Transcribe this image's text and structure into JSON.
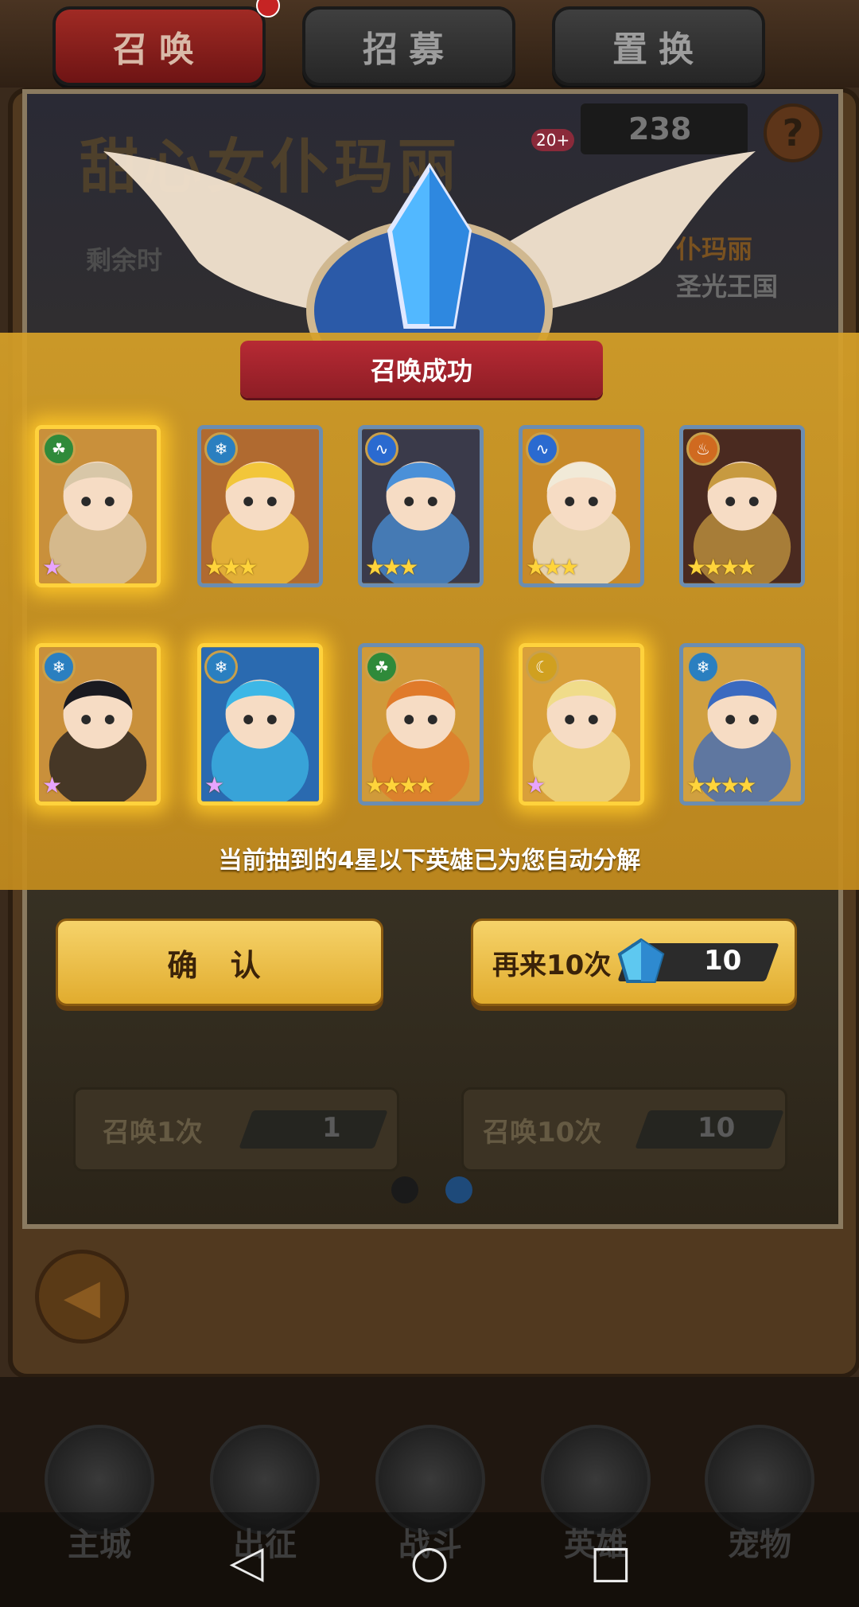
{
  "tabs": [
    {
      "label": "召唤",
      "active": true
    },
    {
      "label": "招募",
      "active": false
    },
    {
      "label": "置换",
      "active": false
    }
  ],
  "banner": {
    "title": "甜心女仆玛丽",
    "remaining_label": "剩余时",
    "gem_count": "238",
    "gem_badge": "20+",
    "help": "?",
    "hero_name": "仆玛丽",
    "hero_realm": "圣光王国"
  },
  "result": {
    "title": "召唤成功",
    "notice": "当前抽到的4星以下英雄已为您自动分解",
    "cards": [
      {
        "element": "wood",
        "stars": 1,
        "purple": true,
        "glow": true,
        "hair": "#d8c7a8",
        "bg": "#c9903b"
      },
      {
        "element": "ice",
        "stars": 3,
        "purple": false,
        "glow": false,
        "hair": "#f2c63a",
        "bg": "#b06a30"
      },
      {
        "element": "water",
        "stars": 3,
        "purple": false,
        "glow": false,
        "hair": "#4a90d8",
        "bg": "#3a3a4a"
      },
      {
        "element": "water",
        "stars": 3,
        "purple": false,
        "glow": false,
        "hair": "#f1ead8",
        "bg": "#c78a2a"
      },
      {
        "element": "fire",
        "stars": 4,
        "purple": false,
        "glow": false,
        "hair": "#c79a40",
        "bg": "#4a2a20"
      },
      {
        "element": "ice",
        "stars": 1,
        "purple": true,
        "glow": true,
        "hair": "#1a1a20",
        "bg": "#c9903b"
      },
      {
        "element": "ice",
        "stars": 1,
        "purple": true,
        "glow": true,
        "hair": "#3db7e6",
        "bg": "#2a6ab0"
      },
      {
        "element": "wood",
        "stars": 4,
        "purple": false,
        "glow": false,
        "hair": "#e07a2a",
        "bg": "#d09a3a"
      },
      {
        "element": "light",
        "stars": 1,
        "purple": true,
        "glow": true,
        "hair": "#f0dc8a",
        "bg": "#d9a03a"
      },
      {
        "element": "ice",
        "stars": 4,
        "purple": false,
        "glow": false,
        "hair": "#3a6ac0",
        "bg": "#d0a040"
      }
    ],
    "confirm_label": "确 认",
    "again_label": "再来10次",
    "again_cost": "10"
  },
  "summon": {
    "once_label": "召唤1次",
    "once_cost": "1",
    "ten_label": "召唤10次",
    "ten_cost": "10"
  },
  "back_icon": "back-arrow-icon",
  "nav": [
    {
      "label": "主城",
      "icon": "castle-icon"
    },
    {
      "label": "出征",
      "icon": "expedition-icon"
    },
    {
      "label": "战斗",
      "icon": "battle-icon"
    },
    {
      "label": "英雄",
      "icon": "hero-icon"
    },
    {
      "label": "宠物",
      "icon": "pet-icon"
    }
  ],
  "colors": {
    "overlay": "#d6a028",
    "success_banner": "#b72a34",
    "button_gold": "#f6d36a",
    "glow": "#ffd23c"
  }
}
